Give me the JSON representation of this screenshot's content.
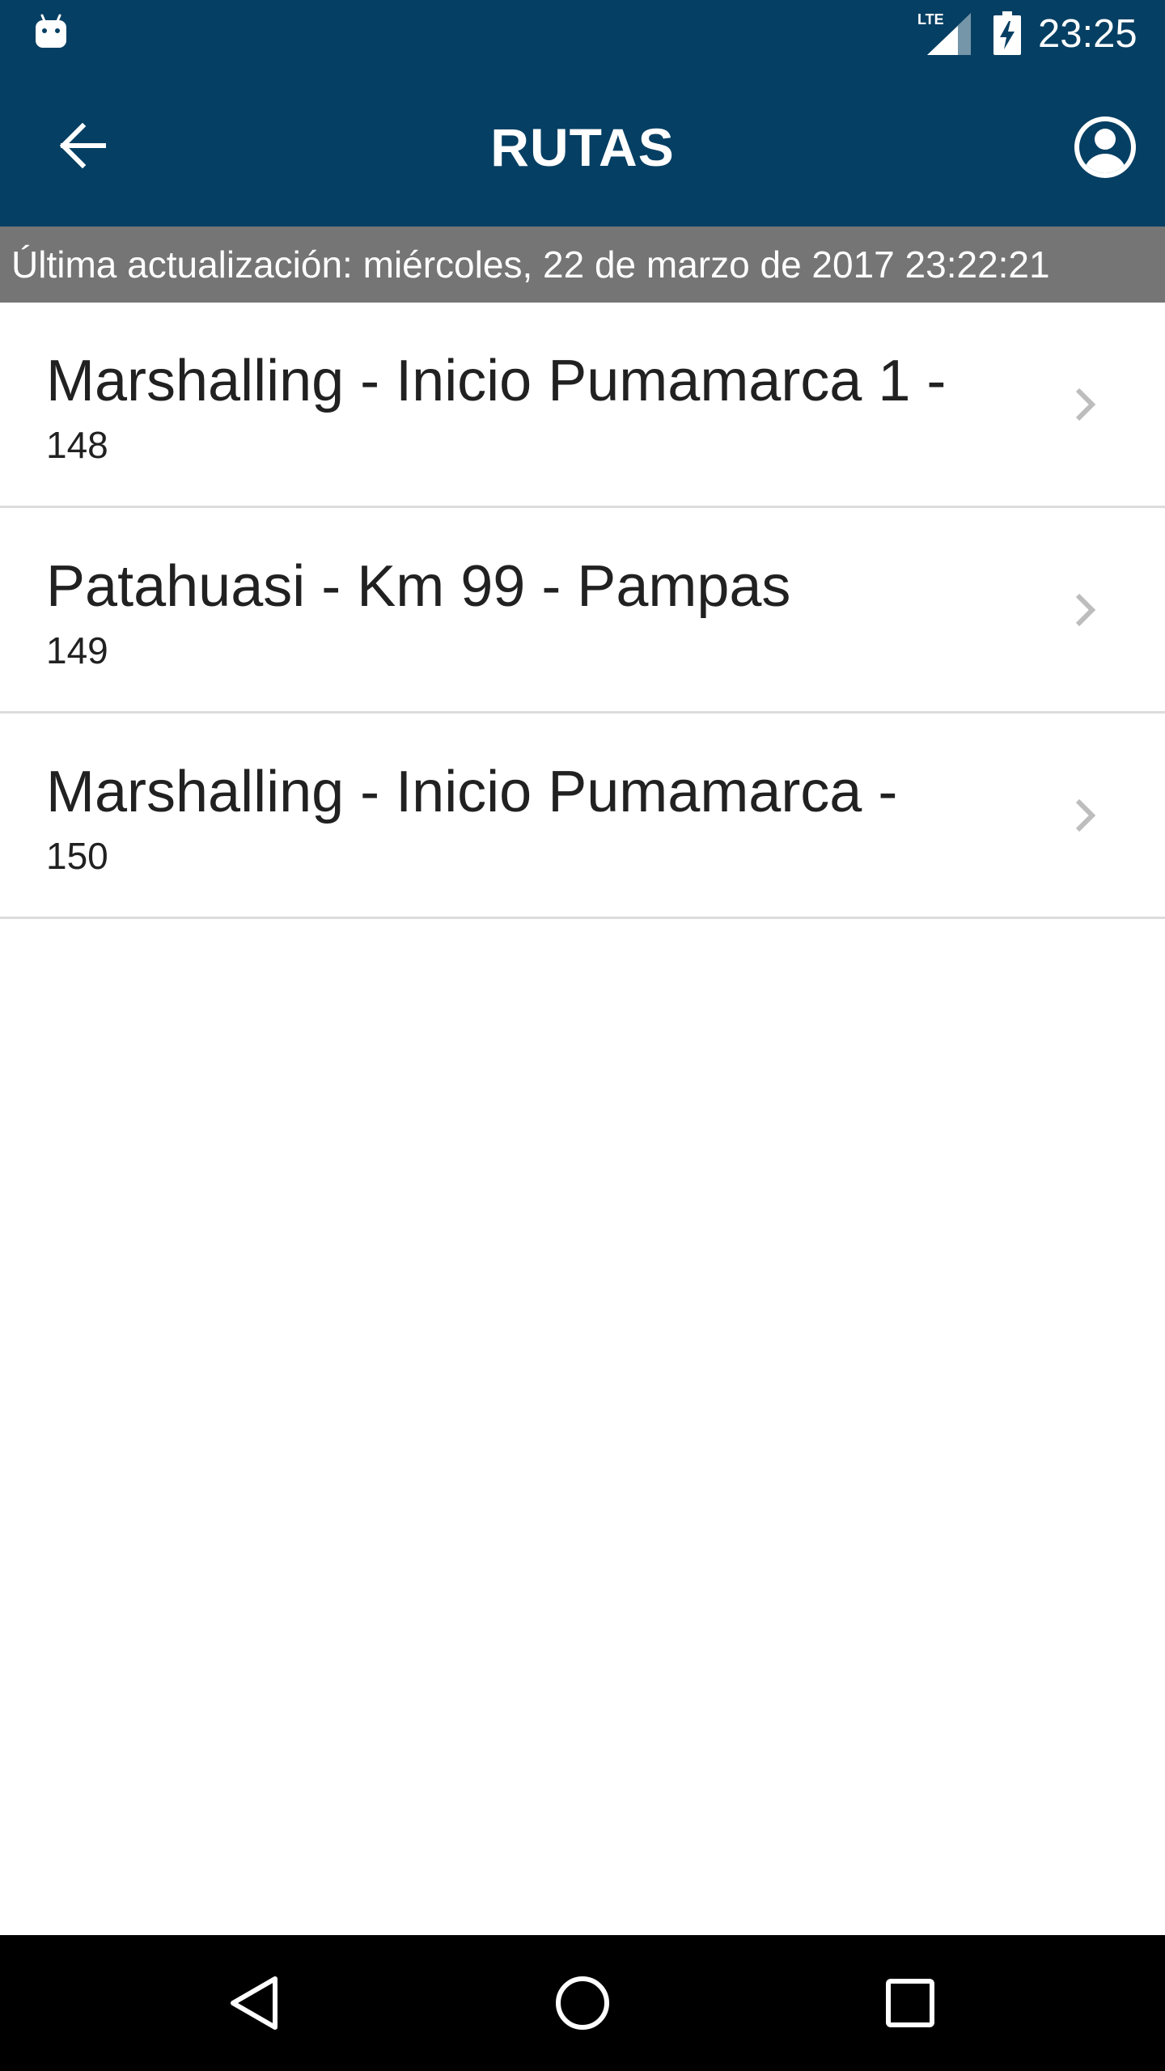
{
  "status_bar": {
    "time": "23:25",
    "network_label": "LTE",
    "icons": [
      "android-icon",
      "lte-signal-icon",
      "battery-charging-icon"
    ]
  },
  "toolbar": {
    "title": "RUTAS",
    "back_icon": "arrow-back-icon",
    "account_icon": "account-circle-icon"
  },
  "update_bar": {
    "text": "Última actualización: miércoles, 22 de marzo de 2017 23:22:21"
  },
  "routes": [
    {
      "name": "Marshalling - Inicio Pumamarca 1 -",
      "number": "148"
    },
    {
      "name": "Patahuasi - Km 99 - Pampas",
      "number": "149"
    },
    {
      "name": "Marshalling - Inicio Pumamarca -",
      "number": "150"
    }
  ],
  "nav_bar": {
    "icons": [
      "nav-back-icon",
      "nav-home-icon",
      "nav-recents-icon"
    ]
  },
  "colors": {
    "primary": "#053f63",
    "update_bar": "#757575",
    "divider": "#dcdcdc",
    "chevron": "#bdbdbd",
    "text": "#212121"
  }
}
